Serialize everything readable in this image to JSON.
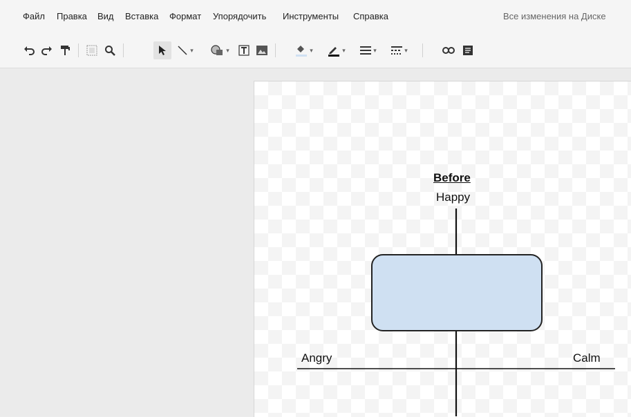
{
  "menu": {
    "items": [
      {
        "label": "Файл"
      },
      {
        "label": "Правка"
      },
      {
        "label": "Вид"
      },
      {
        "label": "Вставка"
      },
      {
        "label": "Формат"
      },
      {
        "label": "Упорядочить"
      },
      {
        "label": "Инструменты"
      },
      {
        "label": "Справка"
      }
    ],
    "save_status": "Все изменения на Диске"
  },
  "toolbar": {
    "tools": [
      {
        "name": "undo-icon",
        "glyph": "↶"
      },
      {
        "name": "redo-icon",
        "glyph": "↷"
      },
      {
        "name": "paint-format-icon",
        "glyph": "🖌"
      },
      {
        "name": "zoom-fit-icon",
        "glyph": "⬚"
      },
      {
        "name": "zoom-icon",
        "glyph": "🔍"
      },
      {
        "name": "select-arrow-icon",
        "glyph": "➤"
      },
      {
        "name": "line-icon",
        "glyph": "╲"
      },
      {
        "name": "shape-icon",
        "glyph": "◐"
      },
      {
        "name": "text-box-icon",
        "glyph": "T"
      },
      {
        "name": "image-icon",
        "glyph": "▣"
      },
      {
        "name": "fill-color-icon",
        "glyph": "◈"
      },
      {
        "name": "line-color-icon",
        "glyph": "✎"
      },
      {
        "name": "line-weight-icon",
        "glyph": "≡"
      },
      {
        "name": "line-dash-icon",
        "glyph": "┅"
      },
      {
        "name": "link-icon",
        "glyph": "⛓"
      },
      {
        "name": "comment-icon",
        "glyph": "▤"
      }
    ]
  },
  "diagram": {
    "title": "Before",
    "top_label": "Happy",
    "left_label": "Angry",
    "right_label": "Calm",
    "box_fill": "#cfe0f2",
    "box_stroke": "#222222"
  }
}
